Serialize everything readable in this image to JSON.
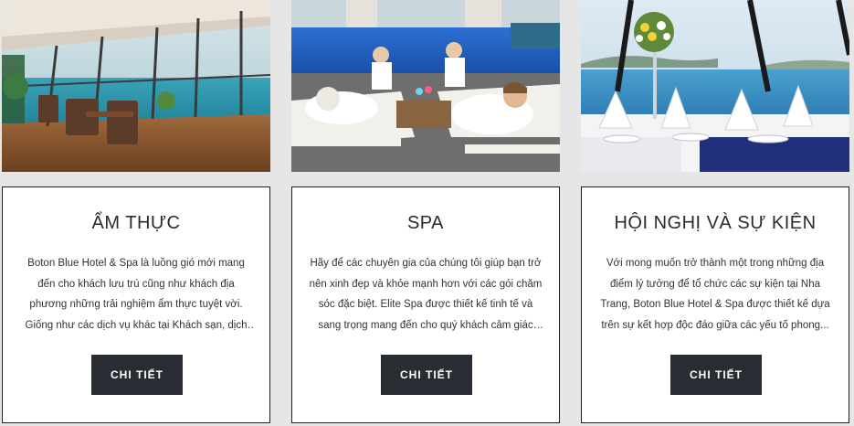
{
  "cards": [
    {
      "image_icon": "restaurant-photo",
      "title": "ẨM THỰC",
      "description": "Boton Blue Hotel & Spa là luồng gió mới mang đến cho khách lưu trú cũng như khách địa phương những trải nghiệm ẩm thực tuyệt vời. Giống như các dịch vụ khác tại Khách sạn, dịch v...",
      "button_label": "CHI TIẾT"
    },
    {
      "image_icon": "spa-photo",
      "title": "SPA",
      "description": "Hãy để các chuyên gia của chúng tôi giúp bạn trở nên xinh đẹp và khỏe mạnh hơn với các gói chăm sóc đặc biệt. Elite Spa được thiết kế tinh tế và sang trọng mang đến cho quý khách cảm giác th...",
      "button_label": "CHI TIẾT"
    },
    {
      "image_icon": "event-hall-photo",
      "title": "HỘI NGHỊ VÀ SỰ KIỆN",
      "description": "Với mong muốn trở thành một trong những địa điểm lý tưởng để tổ chức các sự kiện tại Nha Trang, Boton Blue Hotel & Spa được thiết kế dựa trên sự kết hợp độc đáo giữa các yếu tố phong...",
      "button_label": "CHI TIẾT"
    }
  ],
  "colors": {
    "background": "#e6e6e6",
    "button": "#2a2c33",
    "card_border": "#1e1e1e"
  }
}
